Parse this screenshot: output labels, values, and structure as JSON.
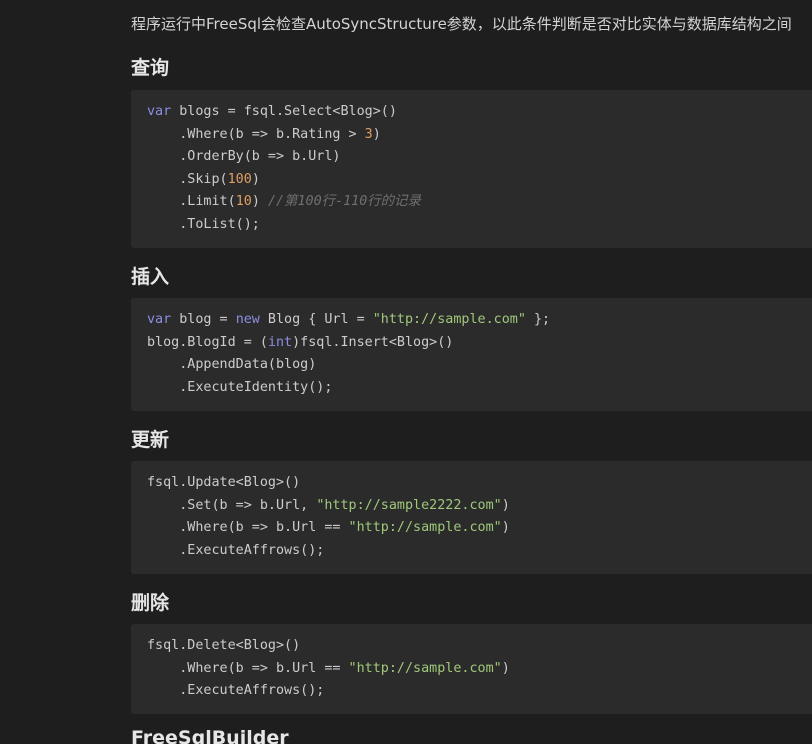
{
  "intro": {
    "text": "程序运行中FreeSql会检查AutoSyncStructure参数，以此条件判断是否对比实体与数据库结构之间"
  },
  "sections": [
    {
      "heading": "查询",
      "lines": [
        [
          [
            "kw",
            "var"
          ],
          [
            "",
            " blogs = fsql.Select<Blog>()"
          ]
        ],
        [
          [
            "",
            "    .Where(b => b.Rating > "
          ],
          [
            "num",
            "3"
          ],
          [
            "",
            ")"
          ]
        ],
        [
          [
            "",
            "    .OrderBy(b => b.Url)"
          ]
        ],
        [
          [
            "",
            "    .Skip("
          ],
          [
            "num",
            "100"
          ],
          [
            "",
            ")"
          ]
        ],
        [
          [
            "",
            "    .Limit("
          ],
          [
            "num",
            "10"
          ],
          [
            "",
            ") "
          ],
          [
            "cm",
            "//第100行-110行的记录"
          ]
        ],
        [
          [
            "",
            "    .ToList();"
          ]
        ]
      ]
    },
    {
      "heading": "插入",
      "lines": [
        [
          [
            "kw",
            "var"
          ],
          [
            "",
            " blog = "
          ],
          [
            "kw",
            "new"
          ],
          [
            "",
            " Blog { Url = "
          ],
          [
            "str",
            "\"http://sample.com\""
          ],
          [
            "",
            " };"
          ]
        ],
        [
          [
            "",
            "blog.BlogId = ("
          ],
          [
            "kw",
            "int"
          ],
          [
            "",
            ")fsql.Insert<Blog>()"
          ]
        ],
        [
          [
            "",
            "    .AppendData(blog)"
          ]
        ],
        [
          [
            "",
            "    .ExecuteIdentity();"
          ]
        ]
      ]
    },
    {
      "heading": "更新",
      "lines": [
        [
          [
            "",
            "fsql.Update<Blog>()"
          ]
        ],
        [
          [
            "",
            "    .Set(b => b.Url, "
          ],
          [
            "str",
            "\"http://sample2222.com\""
          ],
          [
            "",
            ")"
          ]
        ],
        [
          [
            "",
            "    .Where(b => b.Url == "
          ],
          [
            "str",
            "\"http://sample.com\""
          ],
          [
            "",
            ")"
          ]
        ],
        [
          [
            "",
            "    .ExecuteAffrows();"
          ]
        ]
      ]
    },
    {
      "heading": "删除",
      "lines": [
        [
          [
            "",
            "fsql.Delete<Blog>()"
          ]
        ],
        [
          [
            "",
            "    .Where(b => b.Url == "
          ],
          [
            "str",
            "\"http://sample.com\""
          ],
          [
            "",
            ")"
          ]
        ],
        [
          [
            "",
            "    .ExecuteAffrows();"
          ]
        ]
      ]
    },
    {
      "heading": "FreeSqlBuilder",
      "lines": []
    }
  ],
  "colors": {
    "background": "#1e1e1e",
    "code_background": "#2b2b2b",
    "keyword": "#8a8ee0",
    "string": "#9fc87a",
    "number": "#e09e62",
    "comment": "#6f6f6f"
  }
}
